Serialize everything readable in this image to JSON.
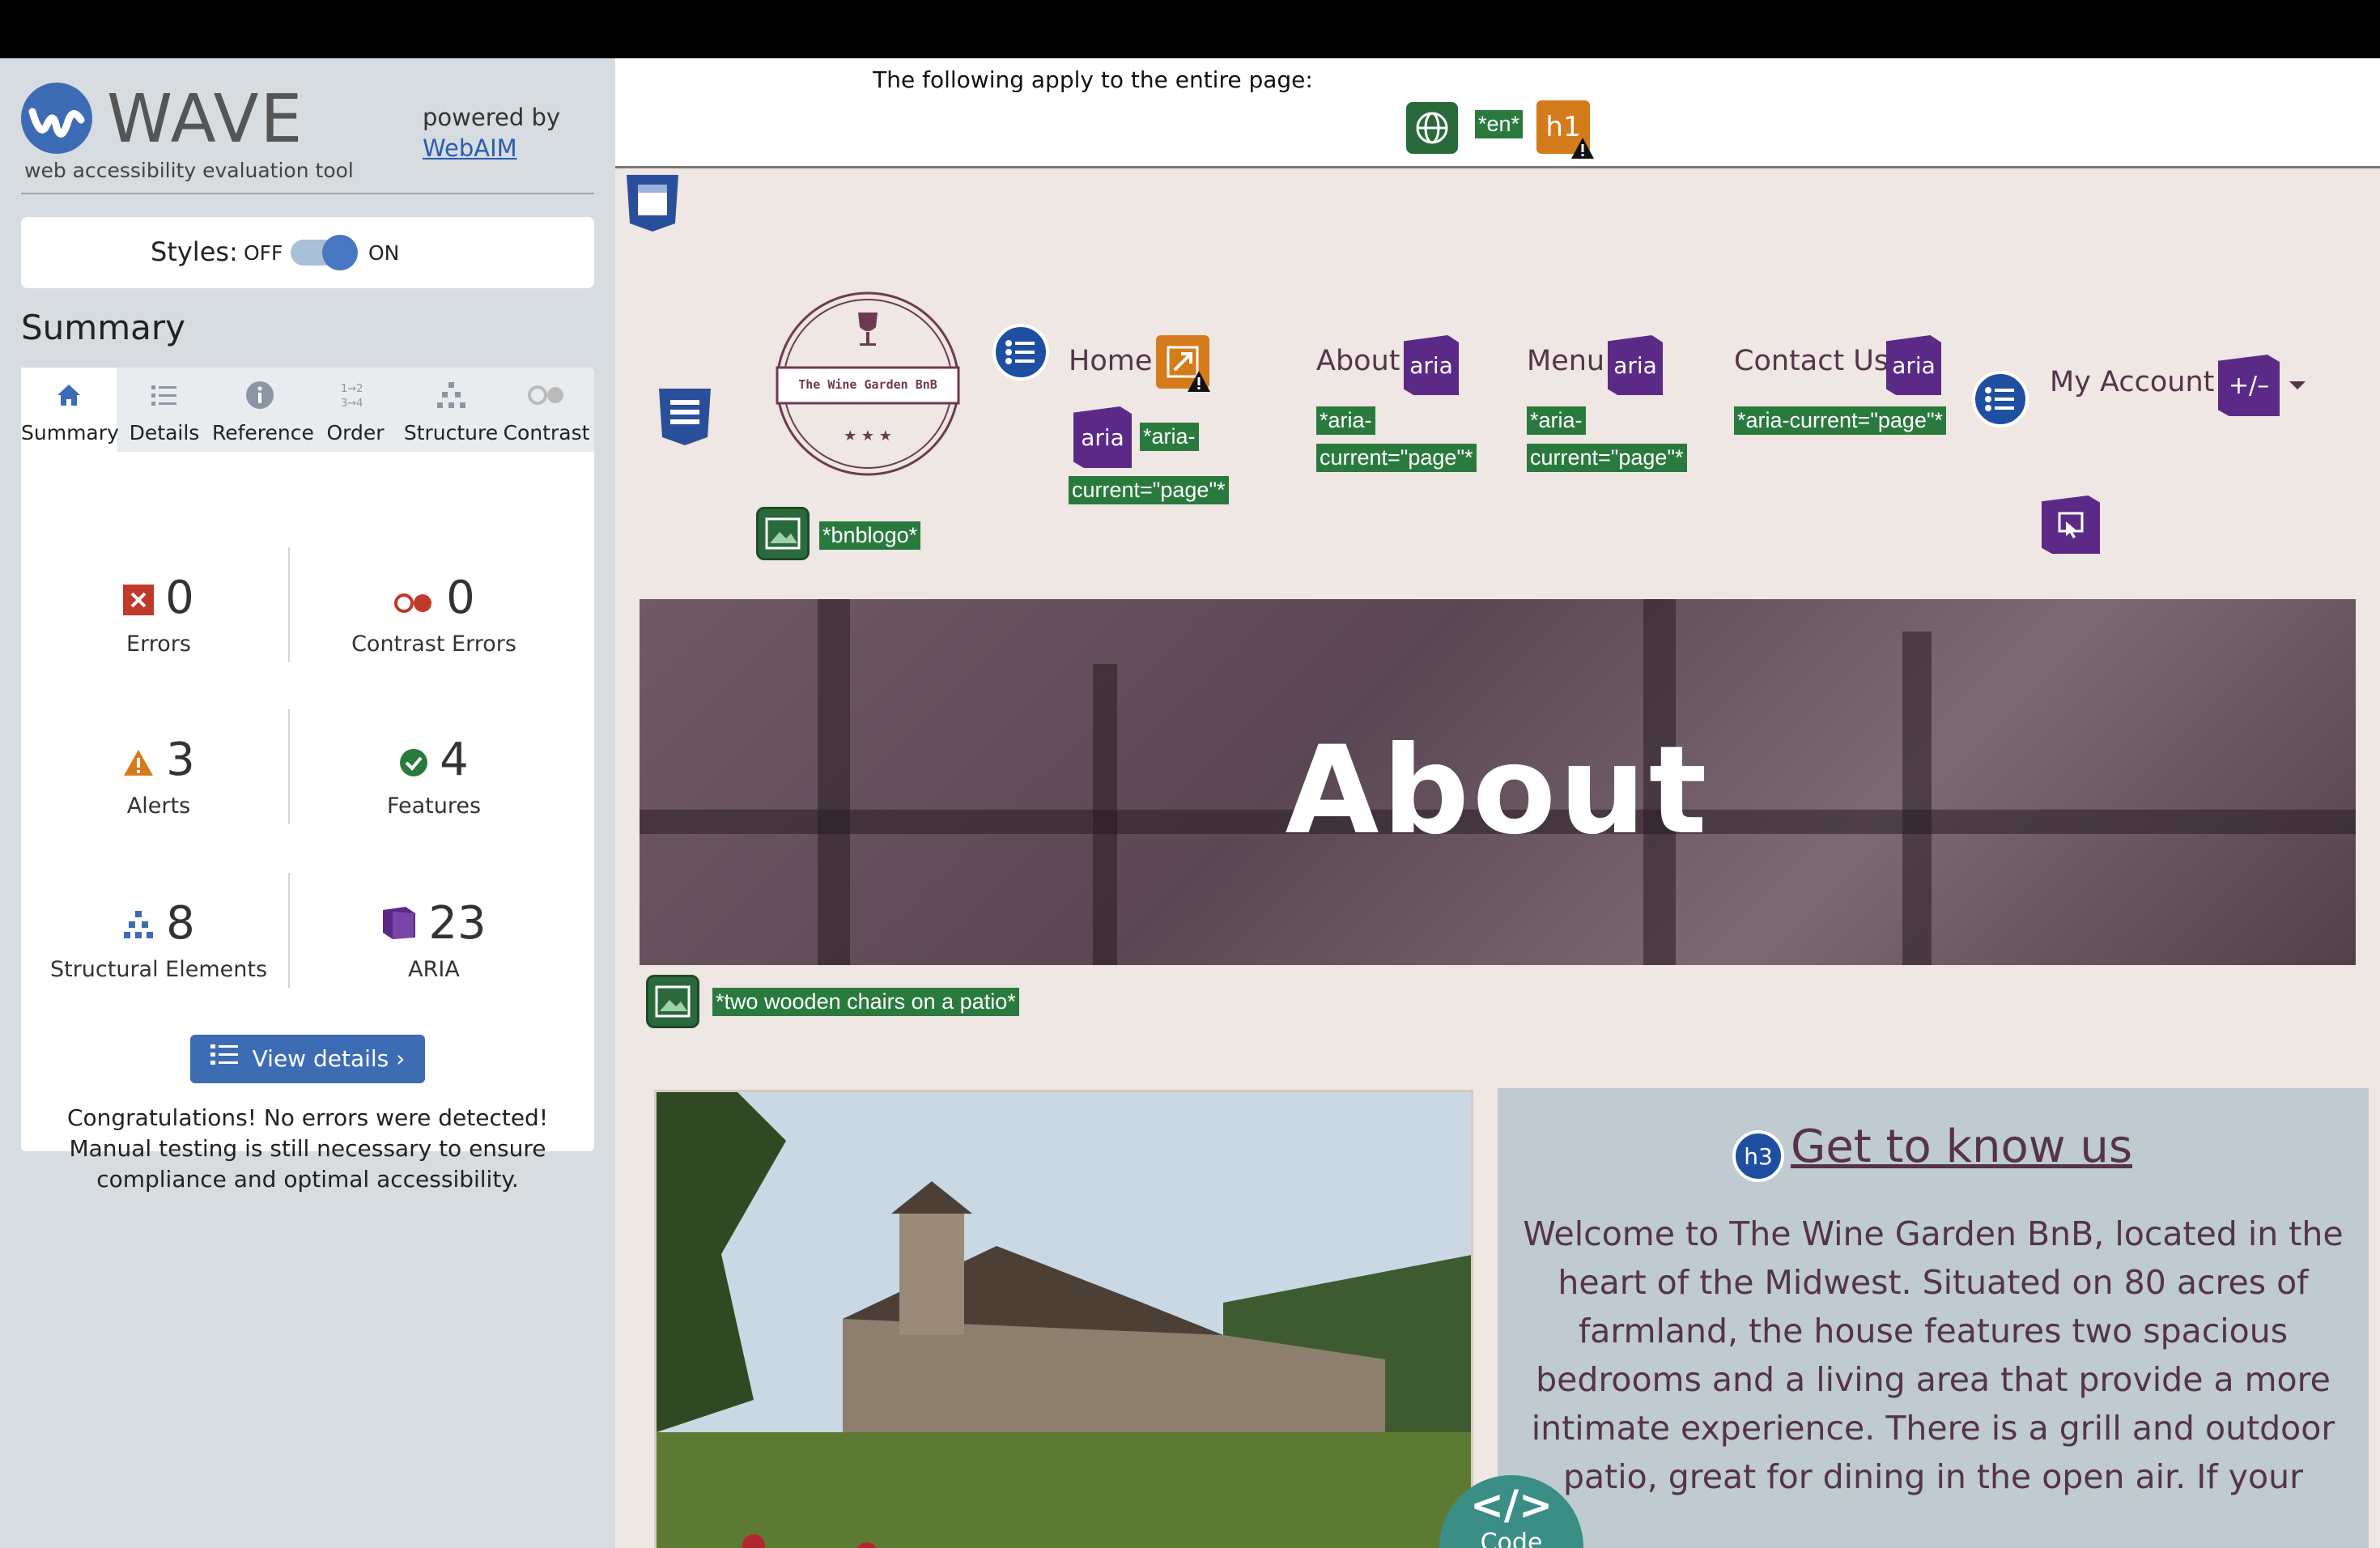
{
  "wave": {
    "title": "WAVE",
    "tagline": "web accessibility evaluation tool",
    "powered_by": "powered by",
    "webaim_link": "WebAIM",
    "styles_label": "Styles:",
    "toggle_off": "OFF",
    "toggle_on": "ON",
    "summary_heading": "Summary",
    "tabs": [
      {
        "label": "Summary",
        "icon": "home-icon"
      },
      {
        "label": "Details",
        "icon": "list-icon"
      },
      {
        "label": "Reference",
        "icon": "info-icon"
      },
      {
        "label": "Order",
        "icon": "order-icon"
      },
      {
        "label": "Structure",
        "icon": "structure-icon"
      },
      {
        "label": "Contrast",
        "icon": "contrast-icon"
      }
    ],
    "stats": {
      "errors": {
        "value": "0",
        "label": "Errors"
      },
      "contrast_errors": {
        "value": "0",
        "label": "Contrast Errors"
      },
      "alerts": {
        "value": "3",
        "label": "Alerts"
      },
      "features": {
        "value": "4",
        "label": "Features"
      },
      "structural": {
        "value": "8",
        "label": "Structural Elements"
      },
      "aria": {
        "value": "23",
        "label": "ARIA"
      }
    },
    "view_details": "View details ›",
    "congrats": "Congratulations! No errors were detected! Manual testing is still necessary to ensure compliance and optimal accessibility."
  },
  "page": {
    "apply_text": "The following apply to the entire page:",
    "lang_tag": "*en*",
    "h1_icon": "h1",
    "logo_text": "The Wine Garden BnB",
    "logo_stars": "★ ★ ★",
    "bnblogo_tag": "*bnblogo*",
    "nav": {
      "home": "Home",
      "about": "About",
      "menu": "Menu",
      "contact": "Contact Us",
      "account": "My Account"
    },
    "aria_icon": "aria",
    "plusminus_icon": "+/–",
    "aria_current_part1": "*aria-",
    "aria_current_part2": "current=\"page\"*",
    "aria_current_full": "*aria-current=\"page\"*",
    "hero_title": "About",
    "hero_alt_tag": "*two wooden chairs on a patio*",
    "h3_icon": "h3",
    "info_heading": "Get to know us",
    "info_text": "Welcome to The Wine Garden BnB, located in the heart of the Midwest. Situated on 80 acres of farmland, the house features two spacious bedrooms and a living area that provide a more intimate experience. There is a grill and outdoor patio, great for dining in the open air. If your",
    "code_label": "Code",
    "code_icon": "</>"
  },
  "colors": {
    "wave_blue": "#3c6cb4",
    "aria_purple": "#5b2a86",
    "alert_orange": "#d47c1b",
    "feature_green": "#2a7a3e",
    "brand_plum": "#54344a",
    "page_bg": "#eee7e3"
  }
}
